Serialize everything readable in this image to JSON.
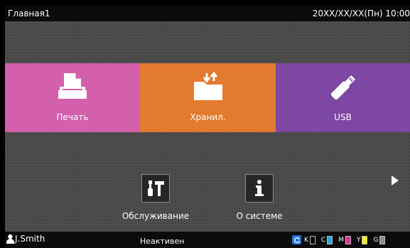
{
  "topbar": {
    "title": "Главная1",
    "datetime": "20XX/XX/XX(Пн) 10:00"
  },
  "tiles": [
    {
      "label": "Печать",
      "icon": "print-icon",
      "color": "#d35fad"
    },
    {
      "label": "Хранил.",
      "icon": "storage-folder-icon",
      "color": "#e47a2e"
    },
    {
      "label": "USB",
      "icon": "usb-icon",
      "color": "#7e47a3"
    }
  ],
  "functions": [
    {
      "label": "Обслуживание",
      "icon": "maintenance-icon"
    },
    {
      "label": "О системе",
      "icon": "info-icon"
    }
  ],
  "statusbar": {
    "user": "J.Smith",
    "status": "Неактивен",
    "inks": [
      {
        "label": "K",
        "color": "#000000",
        "level": 0.0
      },
      {
        "label": "C",
        "color": "#29a7e0",
        "level": 1.0
      },
      {
        "label": "M",
        "color": "#e2348f",
        "level": 1.0
      },
      {
        "label": "Y",
        "color": "#f6ec1c",
        "level": 1.0
      },
      {
        "label": "G",
        "color": "#8c8c8c",
        "level": 1.0
      }
    ]
  }
}
